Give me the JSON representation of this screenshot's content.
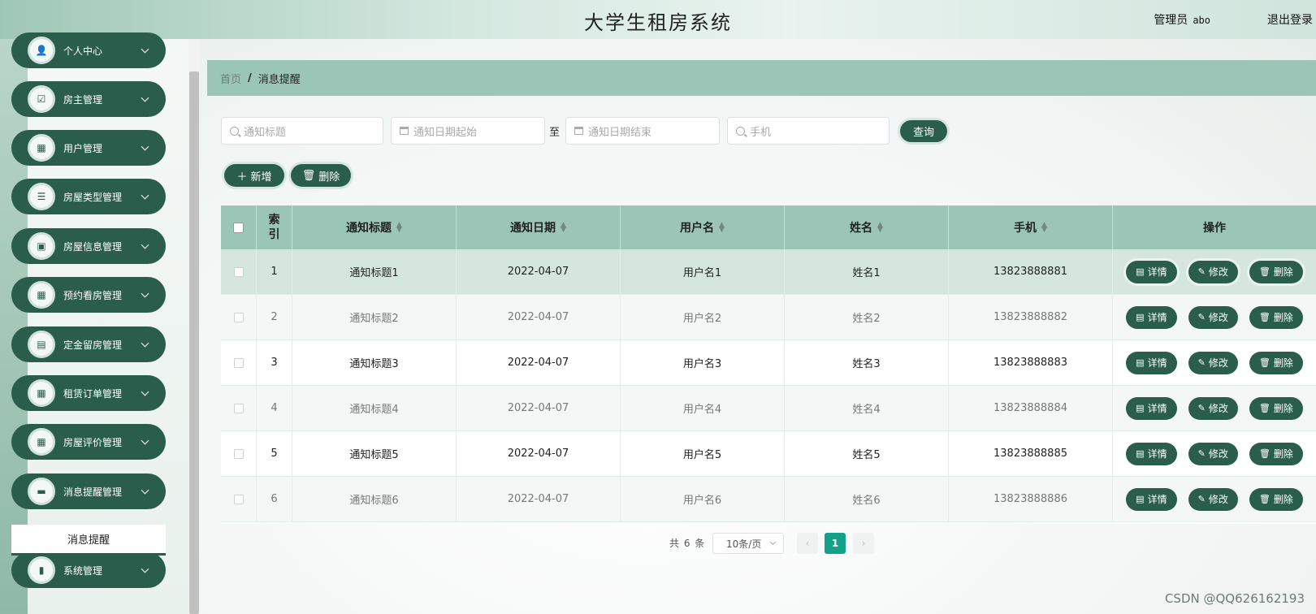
{
  "header": {
    "title": "大学生租房系统",
    "user_label": "管理员",
    "username": "abo",
    "logout": "退出登录"
  },
  "sidebar": {
    "items": [
      {
        "label": "个人中心",
        "icon": "user-icon"
      },
      {
        "label": "房主管理",
        "icon": "clipboard-check-icon"
      },
      {
        "label": "用户管理",
        "icon": "grid-icon"
      },
      {
        "label": "房屋类型管理",
        "icon": "list-icon"
      },
      {
        "label": "房屋信息管理",
        "icon": "briefcase-icon"
      },
      {
        "label": "预约看房管理",
        "icon": "grid-icon"
      },
      {
        "label": "定金留房管理",
        "icon": "clipboard-icon"
      },
      {
        "label": "租赁订单管理",
        "icon": "grid-icon"
      },
      {
        "label": "房屋评价管理",
        "icon": "grid-icon"
      },
      {
        "label": "消息提醒管理",
        "icon": "inbox-icon"
      },
      {
        "label": "系统管理",
        "icon": "book-icon"
      }
    ],
    "active_submenu": "消息提醒"
  },
  "breadcrumb": {
    "home": "首页",
    "separator": "/",
    "current": "消息提醒"
  },
  "search": {
    "title_placeholder": "通知标题",
    "date_start_placeholder": "通知日期起始",
    "date_separator": "至",
    "date_end_placeholder": "通知日期结束",
    "phone_placeholder": "手机",
    "query_button": "查询"
  },
  "toolbar": {
    "add_label": "新增",
    "delete_label": "删除"
  },
  "table": {
    "columns": [
      "索引",
      "通知标题",
      "通知日期",
      "用户名",
      "姓名",
      "手机",
      "操作"
    ],
    "index_header_lines": [
      "索",
      "引"
    ],
    "rows": [
      {
        "index": "1",
        "title": "通知标题1",
        "date": "2022-04-07",
        "username": "用户名1",
        "name": "姓名1",
        "phone": "13823888881"
      },
      {
        "index": "2",
        "title": "通知标题2",
        "date": "2022-04-07",
        "username": "用户名2",
        "name": "姓名2",
        "phone": "13823888882"
      },
      {
        "index": "3",
        "title": "通知标题3",
        "date": "2022-04-07",
        "username": "用户名3",
        "name": "姓名3",
        "phone": "13823888883"
      },
      {
        "index": "4",
        "title": "通知标题4",
        "date": "2022-04-07",
        "username": "用户名4",
        "name": "姓名4",
        "phone": "13823888884"
      },
      {
        "index": "5",
        "title": "通知标题5",
        "date": "2022-04-07",
        "username": "用户名5",
        "name": "姓名5",
        "phone": "13823888885"
      },
      {
        "index": "6",
        "title": "通知标题6",
        "date": "2022-04-07",
        "username": "用户名6",
        "name": "姓名6",
        "phone": "13823888886"
      }
    ],
    "actions": {
      "detail": "详情",
      "edit": "修改",
      "delete": "删除"
    }
  },
  "pagination": {
    "total": "共 6 条",
    "page_size": "10条/页",
    "current_page": "1",
    "prev": "‹",
    "next": "›"
  },
  "watermark": "CSDN @QQ626162193",
  "colors": {
    "primary": "#2a5d4c",
    "header_teal": "#9bc5b6",
    "pager_active": "#15a08a"
  }
}
